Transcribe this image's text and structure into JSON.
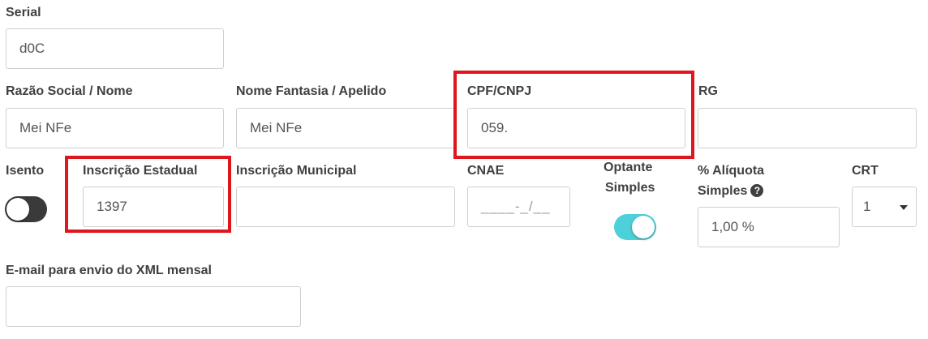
{
  "serial": {
    "label": "Serial",
    "value": "d0C"
  },
  "razao_social": {
    "label": "Razão Social / Nome",
    "value": "Mei NFe"
  },
  "nome_fantasia": {
    "label": "Nome Fantasia / Apelido",
    "value": "Mei NFe"
  },
  "cpf_cnpj": {
    "label": "CPF/CNPJ",
    "value": "059."
  },
  "rg": {
    "label": "RG",
    "value": ""
  },
  "isento": {
    "label": "Isento",
    "checked": false
  },
  "inscricao_estadual": {
    "label": "Inscrição Estadual",
    "value": "1397"
  },
  "inscricao_municipal": {
    "label": "Inscrição Municipal",
    "value": ""
  },
  "cnae": {
    "label": "CNAE",
    "placeholder": "____-_/__"
  },
  "optante_simples": {
    "label_line1": "Optante",
    "label_line2": "Simples",
    "checked": true
  },
  "aliquota_simples": {
    "label_line1": "% Alíquota",
    "label_line2": "Simples",
    "value": "1,00 %",
    "help_icon": "question-circle-icon"
  },
  "crt": {
    "label": "CRT",
    "selected": "1"
  },
  "email_xml": {
    "label": "E-mail para envio do XML mensal",
    "value": ""
  },
  "colors": {
    "highlight": "#e0161e",
    "toggle_on": "#4dd0d9",
    "toggle_off": "#3a3a3a"
  }
}
